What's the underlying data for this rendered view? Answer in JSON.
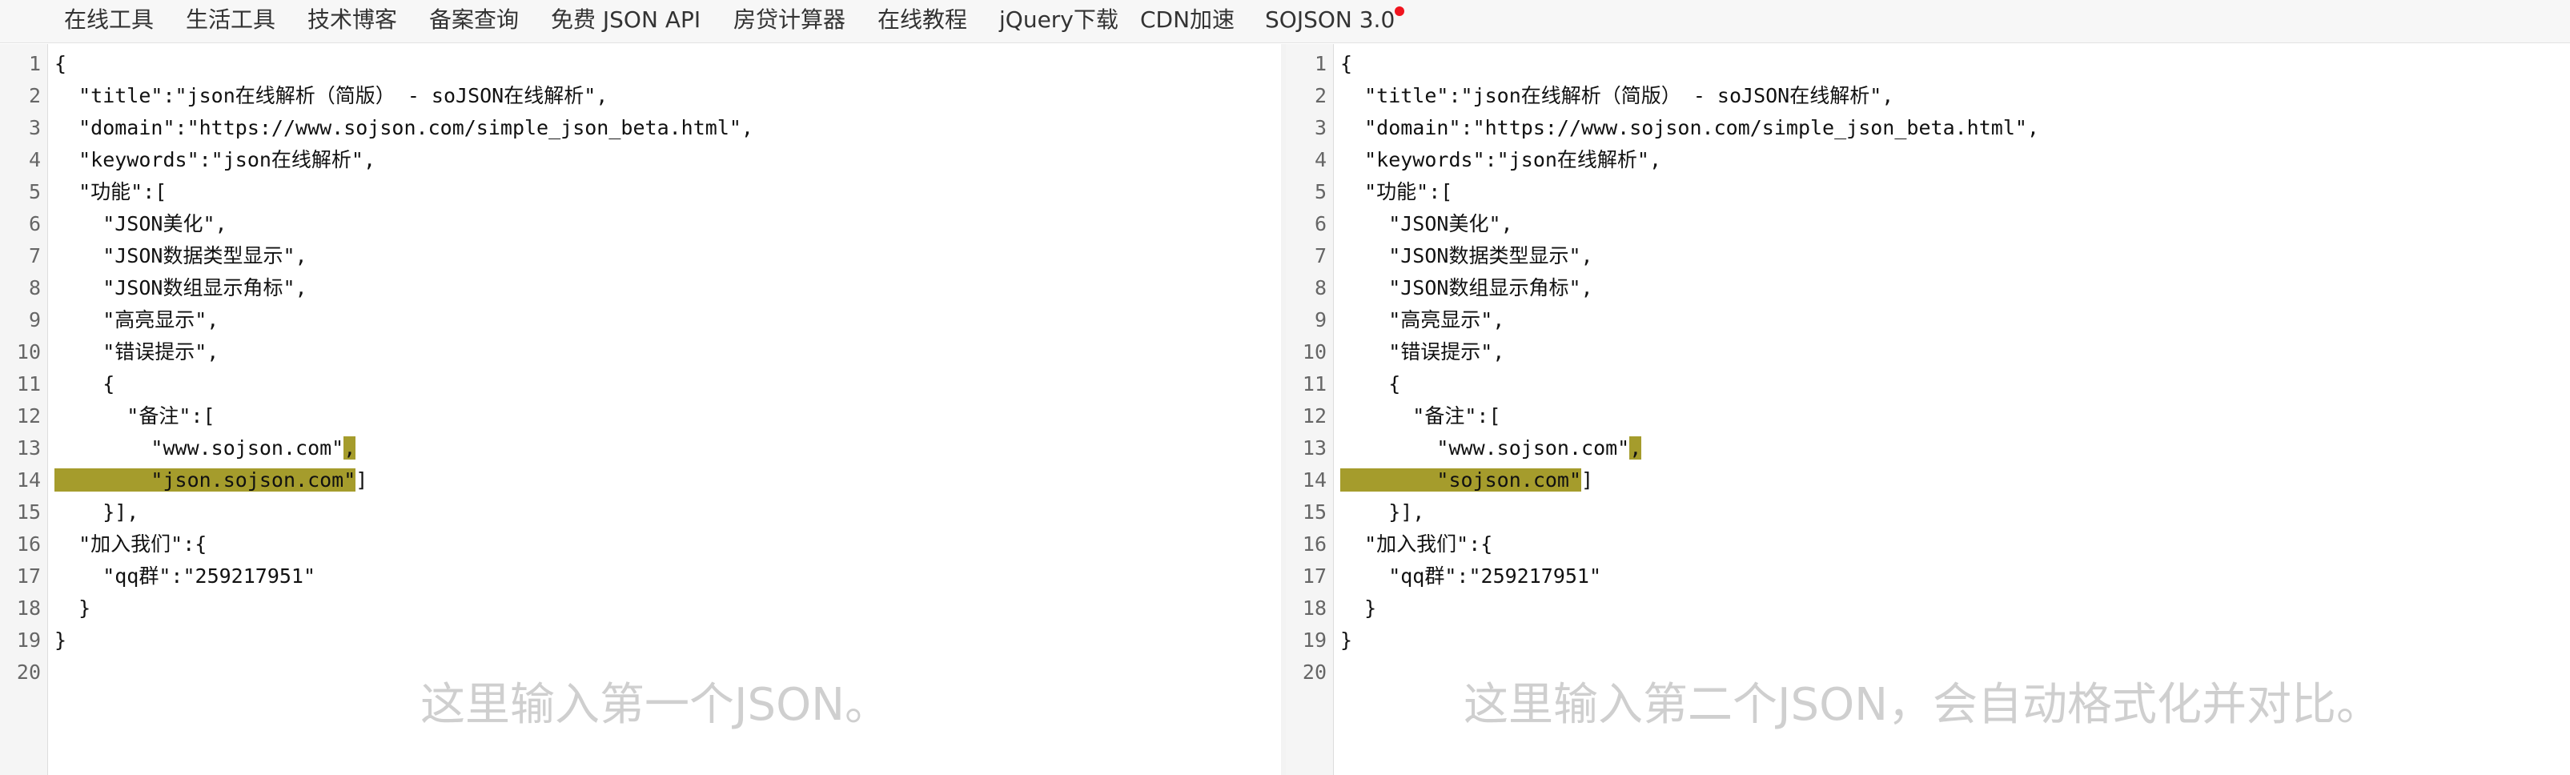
{
  "nav": {
    "items": [
      "在线工具",
      "生活工具",
      "技术博客",
      "备案查询",
      "免费 JSON API",
      "房贷计算器",
      "在线教程",
      "jQuery下载",
      "CDN加速",
      "SOJSON 3.0"
    ],
    "badge_color": "#f0141e"
  },
  "left_editor": {
    "line_numbers": [
      "1",
      "2",
      "3",
      "4",
      "5",
      "6",
      "7",
      "8",
      "9",
      "10",
      "11",
      "12",
      "13",
      "14",
      "15",
      "16",
      "17",
      "18",
      "19",
      "20"
    ],
    "lines": [
      "{",
      "  \"title\":\"json在线解析（简版） - soJSON在线解析\",",
      "  \"domain\":\"https://www.sojson.com/simple_json_beta.html\",",
      "  \"keywords\":\"json在线解析\",",
      "  \"功能\":[",
      "    \"JSON美化\",",
      "    \"JSON数据类型显示\",",
      "    \"JSON数组显示角标\",",
      "    \"高亮显示\",",
      "    \"错误提示\",",
      "    {",
      "      \"备注\":[",
      "        \"www.sojson.com\",",
      "        \"json.sojson.com\"]",
      "    }],",
      "  \"加入我们\":{",
      "    \"qq群\":\"259217951\"",
      "  }",
      "}",
      ""
    ],
    "placeholder": "这里输入第一个JSON。"
  },
  "right_editor": {
    "line_numbers": [
      "1",
      "2",
      "3",
      "4",
      "5",
      "6",
      "7",
      "8",
      "9",
      "10",
      "11",
      "12",
      "13",
      "14",
      "15",
      "16",
      "17",
      "18",
      "19",
      "20"
    ],
    "lines": [
      "{",
      "  \"title\":\"json在线解析（简版） - soJSON在线解析\",",
      "  \"domain\":\"https://www.sojson.com/simple_json_beta.html\",",
      "  \"keywords\":\"json在线解析\",",
      "  \"功能\":[",
      "    \"JSON美化\",",
      "    \"JSON数据类型显示\",",
      "    \"JSON数组显示角标\",",
      "    \"高亮显示\",",
      "    \"错误提示\",",
      "    {",
      "      \"备注\":[",
      "        \"www.sojson.com\",",
      "        \"sojson.com\"]",
      "    }],",
      "  \"加入我们\":{",
      "    \"qq群\":\"259217951\"",
      "  }",
      "}",
      ""
    ],
    "placeholder": "这里输入第二个JSON，会自动格式化并对比。"
  },
  "diff_highlight_color": "#a59c2c"
}
